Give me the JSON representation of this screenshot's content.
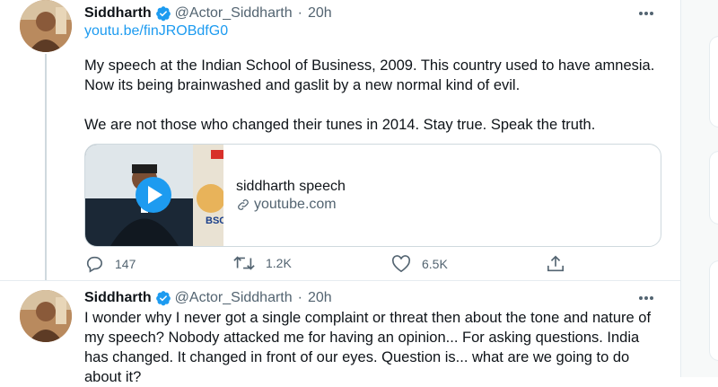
{
  "tweets": [
    {
      "author_name": "Siddharth",
      "handle": "@Actor_Siddharth",
      "separator": "·",
      "time": "20h",
      "link": "youtu.be/finJROBdfG0",
      "body": "My speech at the Indian School of Business, 2009. This country used to have amnesia. Now its being brainwashed and gaslit by a new normal kind of evil.\n\nWe are not those who changed their tunes in 2014. Stay true. Speak the truth.",
      "card": {
        "title": "siddharth speech",
        "domain": "youtube.com"
      },
      "actions": {
        "replies": "147",
        "retweets": "1.2K",
        "likes": "6.5K"
      }
    },
    {
      "author_name": "Siddharth",
      "handle": "@Actor_Siddharth",
      "separator": "·",
      "time": "20h",
      "body": "I wonder why I never got a single complaint or threat then about the tone and nature of my speech? Nobody attacked me for having an opinion... For asking questions. India has changed. It changed in front of our eyes. Question is... what are we going to do about it?"
    }
  ],
  "colors": {
    "link": "#1d9bf0",
    "secondary_text": "#536471",
    "verified_badge": "#1d9bf0"
  },
  "icons": {
    "more": "more-dots-icon",
    "verified": "verified-badge-icon",
    "reply": "reply-icon",
    "retweet": "retweet-icon",
    "like": "like-icon",
    "share": "share-icon",
    "play": "play-icon",
    "link": "link-icon"
  }
}
